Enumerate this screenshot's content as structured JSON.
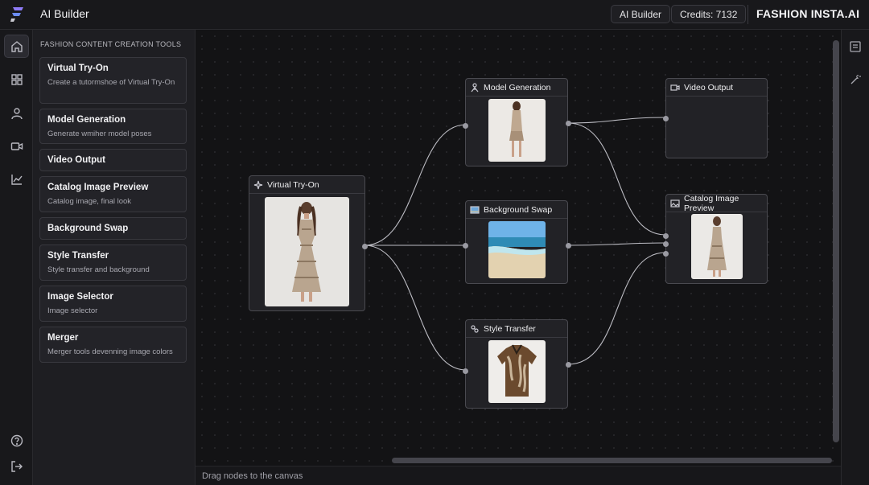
{
  "header": {
    "app_title": "AI Builder",
    "ai_builder_button": "AI Builder",
    "credits": "Credits: 7132",
    "brand": "FASHION INSTA.AI"
  },
  "rail": {
    "items": [
      "home-icon",
      "grid-icon",
      "user-icon",
      "video-icon",
      "chart-icon"
    ],
    "bottom": [
      "help-icon",
      "logout-icon"
    ]
  },
  "panel": {
    "title": "FASHION CONTENT CREATION TOOLS",
    "tools": [
      {
        "title": "Virtual Try-On",
        "desc": "Create a tutormshoe of Virtual Try-On"
      },
      {
        "title": "Model Generation",
        "desc": "Generate wmiher model poses"
      },
      {
        "title": "Video Output",
        "desc": ""
      },
      {
        "title": "Catalog Image Preview",
        "desc": "Catalog image, final look"
      },
      {
        "title": "Background Swap",
        "desc": ""
      },
      {
        "title": "Style Transfer",
        "desc": "Style transfer and background"
      },
      {
        "title": "Image Selector",
        "desc": "Image selector"
      },
      {
        "title": "Merger",
        "desc": "Merger tools devenning image colors"
      }
    ]
  },
  "canvas": {
    "nodes": {
      "virtual_try_on": "Virtual Try-On",
      "model_generation": "Model Generation",
      "background_swap": "Background Swap",
      "style_transfer": "Style Transfer",
      "video_output": "Video Output",
      "catalog_preview": "Catalog Image Preview"
    },
    "status": "Drag nodes to the canvas"
  },
  "colors": {
    "background": "#131315",
    "panel": "#1e1e22",
    "node": "#222226",
    "edge": "#bdbdc4",
    "logo_accent": "#7b6cf6"
  }
}
